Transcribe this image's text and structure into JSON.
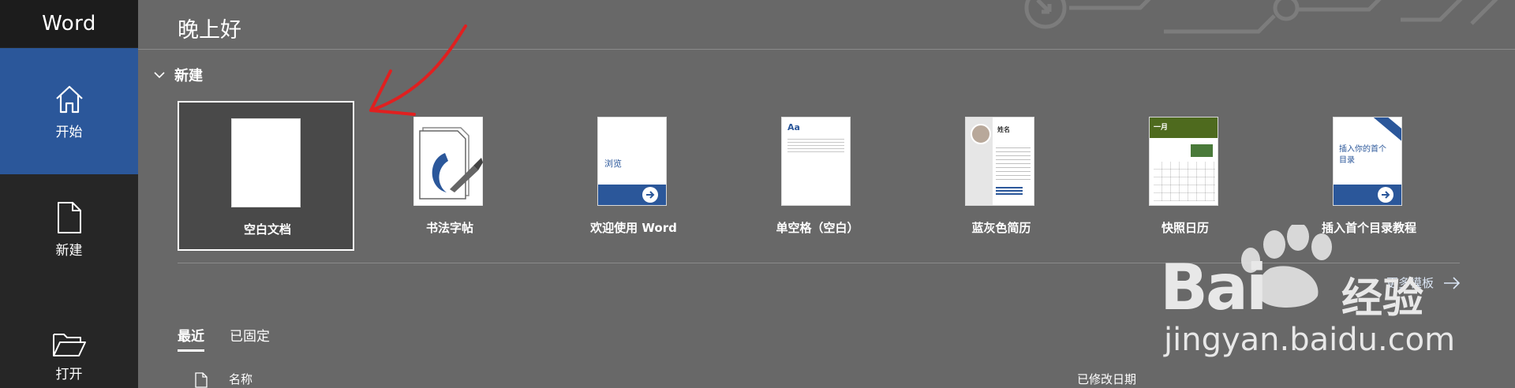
{
  "app": {
    "title": "Word"
  },
  "sidebar": {
    "items": [
      {
        "label": "开始",
        "icon": "home-icon",
        "active": true
      },
      {
        "label": "新建",
        "icon": "new-document-icon"
      },
      {
        "label": "打开",
        "icon": "folder-open-icon"
      }
    ]
  },
  "header": {
    "greeting": "晚上好"
  },
  "new_section": {
    "title": "新建",
    "templates": [
      {
        "label": "空白文档",
        "selected": true
      },
      {
        "label": "书法字帖"
      },
      {
        "label": "欢迎使用 Word",
        "thumb_text": "浏览"
      },
      {
        "label": "单空格（空白）",
        "thumb_text": "Aa"
      },
      {
        "label": "蓝灰色简历",
        "thumb_text": "姓名"
      },
      {
        "label": "快照日历",
        "thumb_text": "一月"
      },
      {
        "label": "插入首个目录教程",
        "thumb_text": "插入你的首个目录"
      }
    ],
    "more_templates": "更多模板"
  },
  "recent": {
    "tabs": [
      "最近",
      "已固定"
    ],
    "columns": {
      "name": "名称",
      "modified": "已修改日期"
    }
  },
  "watermark": {
    "brand": "Bai",
    "brand_cn": "经验",
    "url": "jingyan.baidu.com"
  },
  "colors": {
    "accent": "#2b579a",
    "background": "#686868",
    "sidebar": "#262626",
    "annotation": "#e02020"
  }
}
